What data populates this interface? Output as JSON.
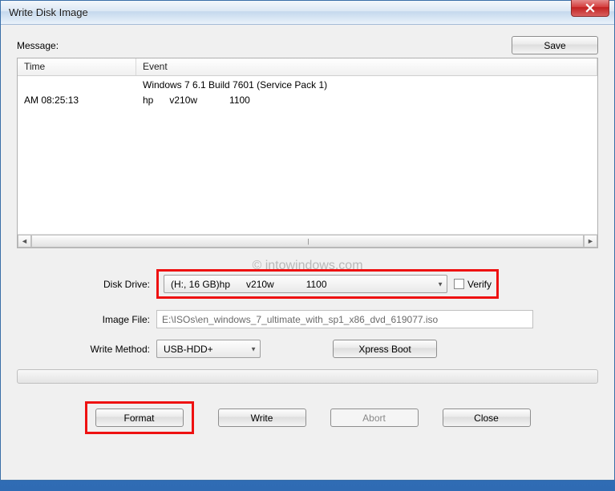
{
  "window": {
    "title": "Write Disk Image"
  },
  "toolbar": {
    "save_label": "Save"
  },
  "labels": {
    "message": "Message:",
    "disk_drive": "Disk Drive:",
    "image_file": "Image File:",
    "write_method": "Write Method:",
    "verify": "Verify"
  },
  "listview": {
    "headers": {
      "time": "Time",
      "event": "Event"
    },
    "rows": [
      {
        "time": "",
        "event": "Windows 7 6.1 Build 7601 (Service Pack 1)"
      },
      {
        "time": "AM 08:25:13",
        "event": "hp      v210w            1100"
      }
    ]
  },
  "disk_drive": {
    "selected": "(H:, 16 GB)hp      v210w            1100"
  },
  "verify_checked": false,
  "image_file": {
    "value": "E:\\ISOs\\en_windows_7_ultimate_with_sp1_x86_dvd_619077.iso"
  },
  "write_method": {
    "selected": "USB-HDD+"
  },
  "buttons": {
    "xpress_boot": "Xpress Boot",
    "format": "Format",
    "write": "Write",
    "abort": "Abort",
    "close": "Close"
  },
  "watermark": "© intowindows.com",
  "chart_data": null
}
